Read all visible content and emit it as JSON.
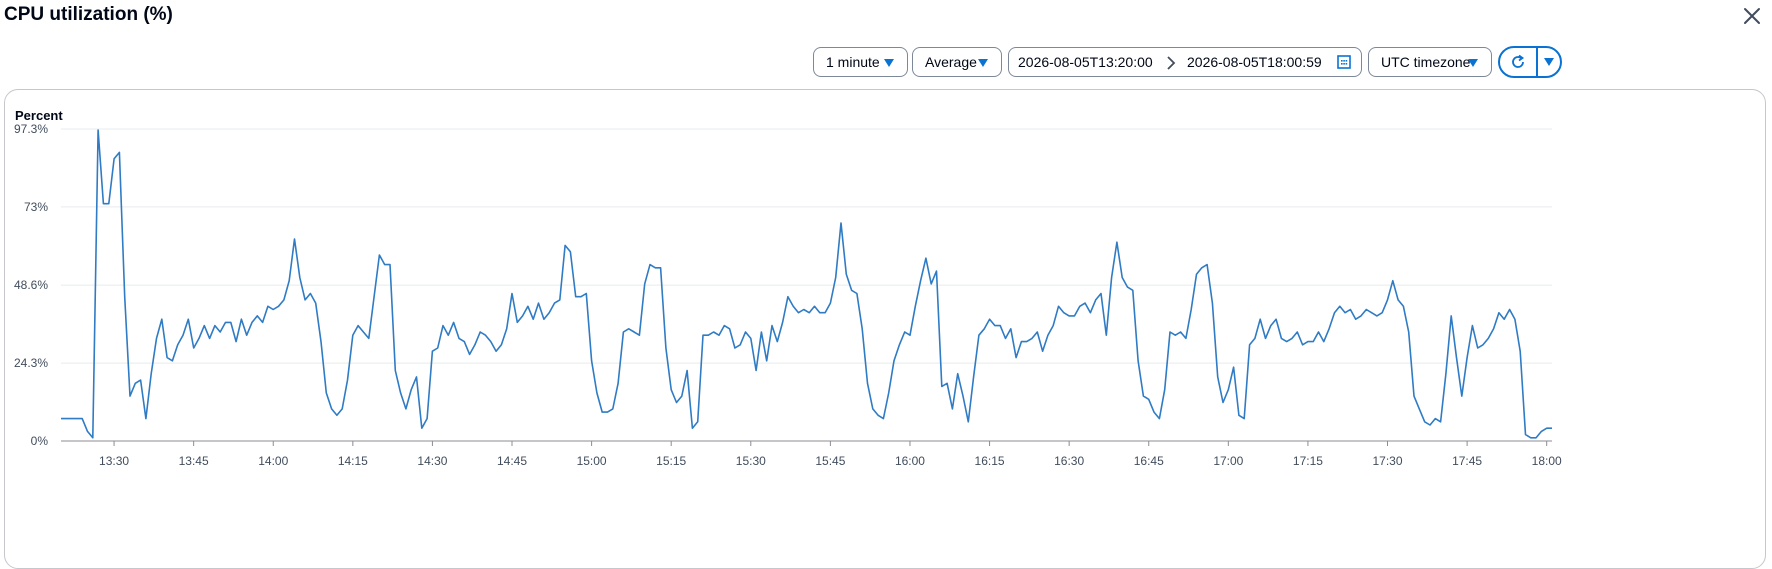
{
  "header": {
    "title": "CPU utilization (%)"
  },
  "controls": {
    "period": "1 minute",
    "statistic": "Average",
    "range_start": "2026-08-05T13:20:00",
    "range_end": "2026-08-05T18:00:59",
    "timezone": "UTC timezone"
  },
  "colors": {
    "accent": "#0972d3",
    "series": "#2f7bc4",
    "grid": "#e9ebed"
  },
  "icons": {
    "close": "close-icon",
    "caret": "caret-down-icon",
    "arrow": "chevron-right-icon",
    "calendar": "calendar-icon",
    "refresh": "refresh-icon"
  },
  "chart_data": {
    "type": "line",
    "ylabel": "Percent",
    "ylim": [
      0,
      97.3
    ],
    "yticks": [
      0,
      24.3,
      48.6,
      73,
      97.3
    ],
    "ytick_labels": [
      "0%",
      "24.3%",
      "48.6%",
      "73%",
      "97.3%"
    ],
    "x_start": "13:20",
    "xticks": [
      "13:30",
      "13:45",
      "14:00",
      "14:15",
      "14:30",
      "14:45",
      "15:00",
      "15:15",
      "15:30",
      "15:45",
      "16:00",
      "16:15",
      "16:30",
      "16:45",
      "17:00",
      "17:15",
      "17:30",
      "17:45",
      "18:00"
    ],
    "grid": true,
    "series": [
      {
        "values": [
          7,
          7,
          7,
          7,
          7,
          3,
          1,
          97,
          74,
          74,
          88,
          90,
          45,
          14,
          18,
          19,
          7,
          21,
          32,
          38,
          26,
          25,
          30,
          33,
          38,
          29,
          32,
          36,
          32,
          36,
          34,
          37,
          37,
          31,
          38,
          33,
          37,
          39,
          37,
          42,
          41,
          42,
          44,
          50,
          63,
          51,
          44,
          46,
          43,
          31,
          15,
          10,
          8,
          10,
          19,
          33,
          36,
          34,
          32,
          45,
          58,
          55,
          55,
          22,
          15,
          10,
          16,
          20,
          4,
          7,
          28,
          29,
          36,
          33,
          37,
          32,
          31,
          27,
          30,
          34,
          33,
          31,
          28,
          30,
          35,
          46,
          37,
          39,
          42,
          38,
          43,
          38,
          40,
          43,
          44,
          61,
          59,
          45,
          45,
          46,
          25,
          15,
          9,
          9,
          10,
          18,
          34,
          35,
          34,
          33,
          49,
          55,
          54,
          54,
          29,
          16,
          12,
          14,
          22,
          4,
          6,
          33,
          33,
          34,
          33,
          36,
          35,
          29,
          30,
          34,
          32,
          22,
          34,
          25,
          36,
          31,
          37,
          45,
          42,
          40,
          41,
          40,
          42,
          40,
          40,
          43,
          51,
          68,
          52,
          47,
          46,
          35,
          18,
          10,
          8,
          7,
          15,
          25,
          30,
          34,
          33,
          42,
          50,
          57,
          49,
          53,
          17,
          18,
          10,
          21,
          14,
          6,
          20,
          33,
          35,
          38,
          36,
          36,
          32,
          35,
          26,
          31,
          31,
          32,
          34,
          28,
          33,
          36,
          42,
          40,
          39,
          39,
          42,
          43,
          40,
          44,
          46,
          33,
          51,
          62,
          51,
          48,
          47,
          25,
          14,
          13,
          9,
          7,
          16,
          34,
          33,
          34,
          32,
          41,
          52,
          54,
          55,
          43,
          20,
          12,
          16,
          23,
          8,
          7,
          30,
          32,
          38,
          32,
          36,
          38,
          32,
          31,
          32,
          34,
          30,
          31,
          31,
          34,
          31,
          35,
          40,
          42,
          40,
          41,
          38,
          39,
          41,
          40,
          39,
          40,
          44,
          50,
          44,
          42,
          34,
          14,
          10,
          6,
          5,
          7,
          6,
          21,
          39,
          26,
          14,
          26,
          36,
          29,
          30,
          32,
          35,
          40,
          38,
          41,
          38,
          28,
          2,
          1,
          1,
          3,
          4,
          4
        ]
      }
    ]
  }
}
